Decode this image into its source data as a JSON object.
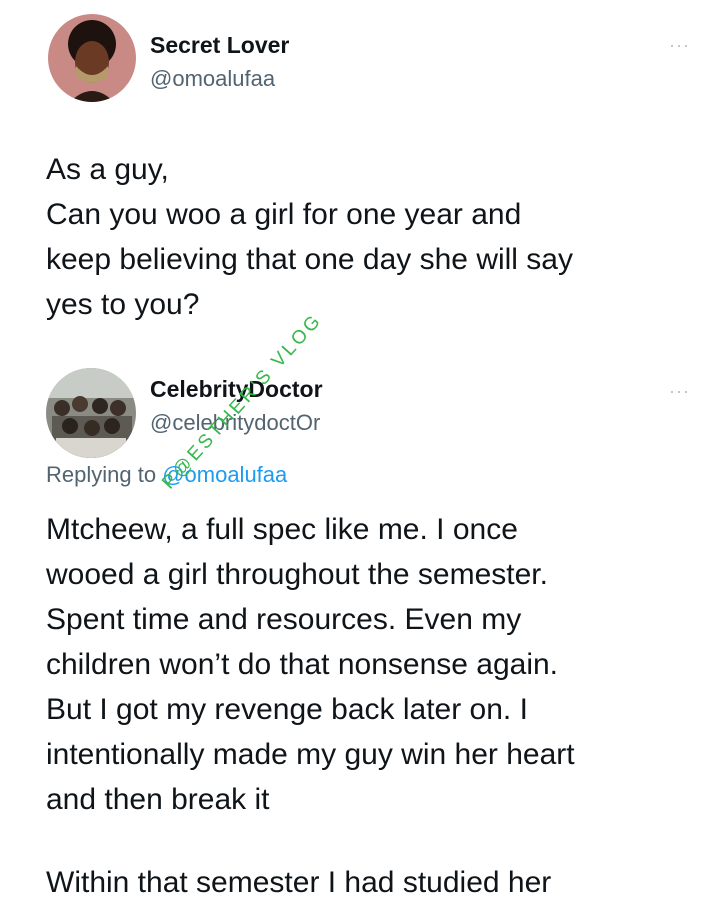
{
  "tweet1": {
    "display_name": "Secret Lover",
    "handle": "@omoalufaa",
    "more": "···",
    "lines": [
      "As a guy,",
      "Can you woo a girl for one year and",
      "keep believing that one day she will say",
      "yes to you?"
    ]
  },
  "tweet2": {
    "display_name": "CelebrityDoctor",
    "handle": "@celebritydoctOr",
    "more": "···",
    "replying_prefix": "Replying to ",
    "replying_mention": "@omoalufaa",
    "lines": [
      "Mtcheew, a full spec like me. I once",
      "wooed a girl throughout the semester.",
      "Spent time and resources. Even my",
      "children won’t do that nonsense again.",
      "But I got my revenge back later on. I",
      "intentionally made my guy win her heart",
      "and then break it"
    ],
    "trailing": "Within that semester I had studied her"
  },
  "watermark": {
    "text": "P@ESTHER'S VLOG",
    "color": "#35b94a"
  },
  "colors": {
    "text": "#0f1419",
    "secondary": "#536471",
    "link": "#1d9bf0"
  }
}
